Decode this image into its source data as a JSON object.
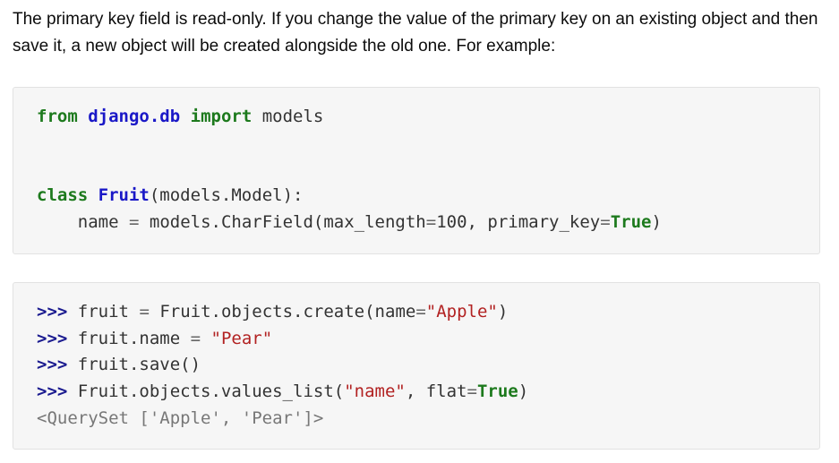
{
  "intro": {
    "text": "The primary key field is read-only. If you change the value of the primary key on an existing object and then save it, a new object will be created alongside the old one. For example:"
  },
  "code1": {
    "line1": {
      "kw_from": "from",
      "module": "django.db",
      "kw_import": "import",
      "name": "models"
    },
    "line2": {
      "kw_class": "class",
      "class_name": "Fruit",
      "base": "(models.Model):"
    },
    "line3": {
      "indent": "    ",
      "field": "name",
      "eq": "=",
      "call": "models.CharField(max_length",
      "eq2": "=",
      "num": "100, primary_key",
      "eq3": "=",
      "true": "True",
      "close": ")"
    }
  },
  "code2": {
    "prompt": ">>>",
    "l1": {
      "var": "fruit",
      "eq": "=",
      "call": "Fruit.objects.create(name",
      "eq2": "=",
      "str": "\"Apple\"",
      "close": ")"
    },
    "l2": {
      "var": "fruit.name",
      "eq": "=",
      "str": "\"Pear\""
    },
    "l3": {
      "call": "fruit.save()"
    },
    "l4": {
      "call": "Fruit.objects.values_list(",
      "str": "\"name\"",
      "mid": ", flat",
      "eq": "=",
      "true": "True",
      "close": ")"
    },
    "output": "<QuerySet ['Apple', 'Pear']>"
  }
}
